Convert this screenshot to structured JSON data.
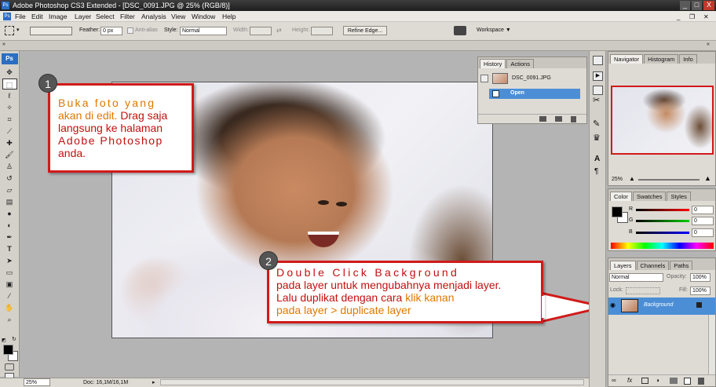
{
  "titlebar": {
    "title": "Adobe Photoshop CS3 Extended - [DSC_0091.JPG @ 25% (RGB/8)]",
    "min": "_",
    "max": "□",
    "close": "X"
  },
  "menubar": {
    "items": [
      "File",
      "Edit",
      "Image",
      "Layer",
      "Select",
      "Filter",
      "Analysis",
      "View",
      "Window",
      "Help"
    ]
  },
  "options": {
    "feather_label": "Feather:",
    "feather_value": "0 px",
    "antialias_label": "Anti-alias",
    "style_label": "Style:",
    "style_value": "Normal",
    "width_label": "Width:",
    "height_label": "Height:",
    "refine_edge": "Refine Edge...",
    "workspace": "Workspace ▼"
  },
  "callout1": {
    "number": "1",
    "line1": "Buka foto yang",
    "line2a": "akan di edit.",
    "line2b": " Drag saja",
    "line3": "langsung ke halaman",
    "line4": "Adobe Photoshop",
    "line5": "anda."
  },
  "callout2": {
    "number": "2",
    "line1": "Double Click Background",
    "line2": "pada layer untuk mengubahnya menjadi layer.",
    "line3a": "Lalu duplikat dengan cara ",
    "line3b": "klik kanan",
    "line4": "pada layer > duplicate layer"
  },
  "history": {
    "tabs": [
      "History",
      "Actions"
    ],
    "snapshot": "DSC_0091.JPG",
    "state": "Open"
  },
  "navigator": {
    "tabs": [
      "Navigator",
      "Histogram",
      "Info"
    ],
    "zoom": "25%"
  },
  "color": {
    "tabs": [
      "Color",
      "Swatches",
      "Styles"
    ],
    "r_label": "R",
    "g_label": "G",
    "b_label": "B",
    "r": "0",
    "g": "0",
    "b": "0"
  },
  "layers": {
    "tabs": [
      "Layers",
      "Channels",
      "Paths"
    ],
    "blend": "Normal",
    "opacity_label": "Opacity:",
    "opacity": "100%",
    "lock_label": "Lock:",
    "fill_label": "Fill:",
    "fill": "100%",
    "layer_name": "Background"
  },
  "status": {
    "zoom": "25%",
    "doc": "Doc: 16,1M/16,1M"
  },
  "toolbox": {
    "logo": "Ps"
  },
  "colors": {
    "accent": "#d11a1a",
    "highlight": "#4b8ed6",
    "orange": "#e07800"
  }
}
